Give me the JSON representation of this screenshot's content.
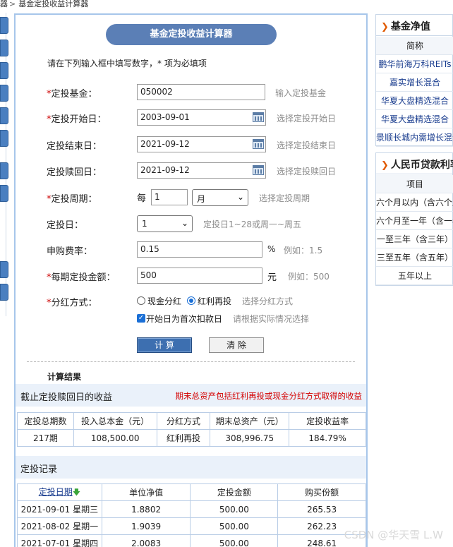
{
  "breadcrumb": {
    "prefix": "器",
    "current": "基金定投收益计算器"
  },
  "calculator": {
    "title": "基金定投收益计算器",
    "instruction": "请在下列输入框中填写数字，* 项为必填项",
    "required_mark": "*",
    "fields": {
      "fund": {
        "label": "定投基金：",
        "value": "050002",
        "hint": "输入定投基金"
      },
      "start_date": {
        "label": "定投开始日：",
        "value": "2003-09-01",
        "hint": "选择定投开始日"
      },
      "end_date": {
        "label": "定投结束日：",
        "value": "2021-09-12",
        "hint": "选择定投结束日"
      },
      "redeem_date": {
        "label": "定投赎回日：",
        "value": "2021-09-12",
        "hint": "选择定投赎回日"
      },
      "period": {
        "label": "定投周期：",
        "prefix": "每",
        "value": "1",
        "unit": "月",
        "hint": "选择定投周期"
      },
      "invest_day": {
        "label": "定投日：",
        "value": "1",
        "hint": "定投日1~28或周一~周五"
      },
      "fee_rate": {
        "label": "申购费率：",
        "value": "0.15",
        "unit": "%",
        "hint": "例如：1.5"
      },
      "amount": {
        "label": "每期定投金额：",
        "value": "500",
        "unit": "元",
        "hint": "例如：500"
      },
      "dividend": {
        "label": "分红方式：",
        "option_cash": "现金分红",
        "option_reinvest": "红利再投",
        "selected": "红利再投",
        "hint": "选择分红方式"
      },
      "first_day": {
        "label": "开始日为首次扣款日",
        "checked": true,
        "hint": "请根据实际情况选择"
      }
    },
    "calc_button": "计 算",
    "clear_button": "清 除"
  },
  "results": {
    "heading": "计算结果",
    "summary_title": "截止定投赎回日的收益",
    "summary_note": "期末总资产包括红利再投或现金分红方式取得的收益",
    "summary_headers": [
      "定投总期数",
      "投入总本金（元）",
      "分红方式",
      "期末总资产（元）",
      "定投收益率"
    ],
    "summary_values": [
      "217期",
      "108,500.00",
      "红利再投",
      "308,996.75",
      "184.79%"
    ],
    "records_title": "定投记录",
    "record_headers": [
      "定投日期",
      "单位净值",
      "定投金额",
      "购买份额"
    ],
    "records": [
      [
        "2021-09-01 星期三",
        "1.8802",
        "500.00",
        "265.53"
      ],
      [
        "2021-08-02 星期一",
        "1.9039",
        "500.00",
        "262.23"
      ],
      [
        "2021-07-01 星期四",
        "2.0083",
        "500.00",
        "248.61"
      ]
    ]
  },
  "sidebar": {
    "nav": {
      "title": "基金净值",
      "column": "简称",
      "items": [
        "鹏华前海万科REITs",
        "嘉实增长混合",
        "华夏大盘精选混合",
        "华夏大盘精选混合",
        "景顺长城内需增长混合"
      ]
    },
    "rates": {
      "title": "人民币贷款利率",
      "column": "项目",
      "items": [
        "六个月以内（含六个月）",
        "六个月至一年（含一年）",
        "一至三年（含三年）",
        "三至五年（含五年）",
        "五年以上"
      ]
    }
  },
  "watermark": "CSDN @华天雪 L.W",
  "colors": {
    "title_pill": "#5b7fb6",
    "panel_border": "#a7c6ea",
    "accent_red": "#d40000",
    "link_blue": "#1a3d8f"
  }
}
